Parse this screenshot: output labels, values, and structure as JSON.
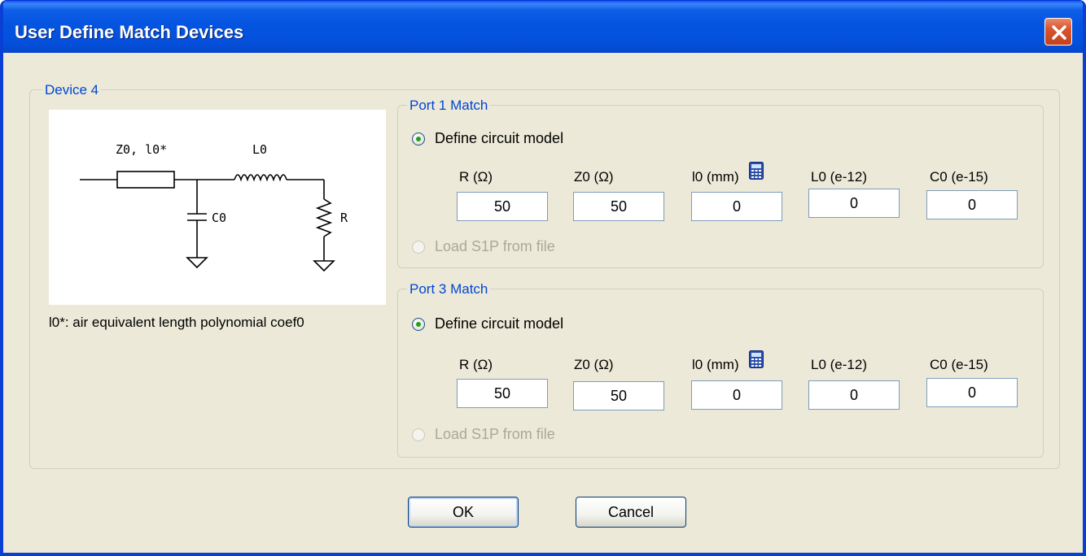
{
  "window": {
    "title": "User Define Match Devices"
  },
  "device": {
    "group_label": "Device 4",
    "note": "l0*: air equivalent length polynomial coef0",
    "circuit_labels": {
      "tline": "Z0, l0*",
      "inductor": "L0",
      "capacitor": "C0",
      "resistor": "R"
    }
  },
  "ports": [
    {
      "group_label": "Port 1 Match",
      "define_label": "Define circuit model",
      "define_checked": true,
      "load_label": "Load S1P from file",
      "load_enabled": false,
      "fields": [
        {
          "label": "R (Ω)",
          "value": "50"
        },
        {
          "label": "Z0 (Ω)",
          "value": "50"
        },
        {
          "label": "l0 (mm)",
          "value": "0"
        },
        {
          "label": "L0 (e-12)",
          "value": "0"
        },
        {
          "label": "C0 (e-15)",
          "value": "0"
        }
      ]
    },
    {
      "group_label": "Port 3 Match",
      "define_label": "Define circuit model",
      "define_checked": true,
      "load_label": "Load S1P from file",
      "load_enabled": false,
      "fields": [
        {
          "label": "R (Ω)",
          "value": "50"
        },
        {
          "label": "Z0 (Ω)",
          "value": "50"
        },
        {
          "label": "l0 (mm)",
          "value": "0"
        },
        {
          "label": "L0 (e-12)",
          "value": "0"
        },
        {
          "label": "C0 (e-15)",
          "value": "0"
        }
      ]
    }
  ],
  "buttons": {
    "ok": "OK",
    "cancel": "Cancel"
  },
  "icons": {
    "close": "close-icon",
    "calculator": "calculator-icon"
  },
  "colors": {
    "title_bar": "#0454e0",
    "group_label": "#0046d5",
    "dialog_bg": "#ece9d8"
  }
}
